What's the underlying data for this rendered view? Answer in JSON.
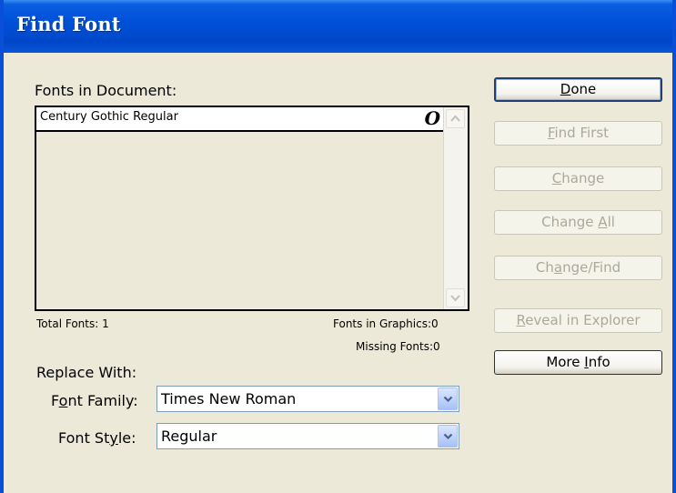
{
  "window": {
    "title": "Find Font"
  },
  "fonts_in_document": {
    "label": "Fonts in Document:",
    "items": [
      {
        "name": "Century Gothic Regular",
        "type_glyph": "O"
      }
    ]
  },
  "stats": {
    "total_fonts": "Total Fonts: 1",
    "fonts_in_graphics": "Fonts in Graphics:0",
    "missing_fonts": "Missing Fonts:0"
  },
  "replace_with": {
    "label": "Replace With:",
    "font_family": {
      "label_before": "F",
      "label_accel": "o",
      "label_after": "nt Family:",
      "value": "Times New Roman"
    },
    "font_style": {
      "label_before": "Font St",
      "label_accel": "y",
      "label_after": "le:",
      "value": "Regular"
    }
  },
  "buttons": {
    "done": {
      "before": "",
      "accel": "D",
      "after": "one",
      "enabled": true
    },
    "find_first": {
      "before": "",
      "accel": "F",
      "after": "ind First",
      "enabled": false
    },
    "change": {
      "before": "",
      "accel": "C",
      "after": "hange",
      "enabled": false
    },
    "change_all": {
      "before": "Change ",
      "accel": "A",
      "after": "ll",
      "enabled": false
    },
    "change_find": {
      "before": "Ch",
      "accel": "a",
      "after": "nge/Find",
      "enabled": false
    },
    "reveal_in_explorer": {
      "before": "",
      "accel": "R",
      "after": "eveal in Explorer",
      "enabled": false
    },
    "more_info": {
      "before": "More ",
      "accel": "I",
      "after": "nfo",
      "enabled": true
    }
  },
  "icons": {
    "opentype": "opentype-font-icon",
    "scroll_up": "chevron-up-icon",
    "scroll_down": "chevron-down-icon",
    "dropdown": "chevron-down-icon"
  },
  "colors": {
    "title_bar": "#0051d8",
    "dialog_face": "#ece9d8",
    "disabled_text": "#aca899",
    "button_border": "#003c74"
  }
}
